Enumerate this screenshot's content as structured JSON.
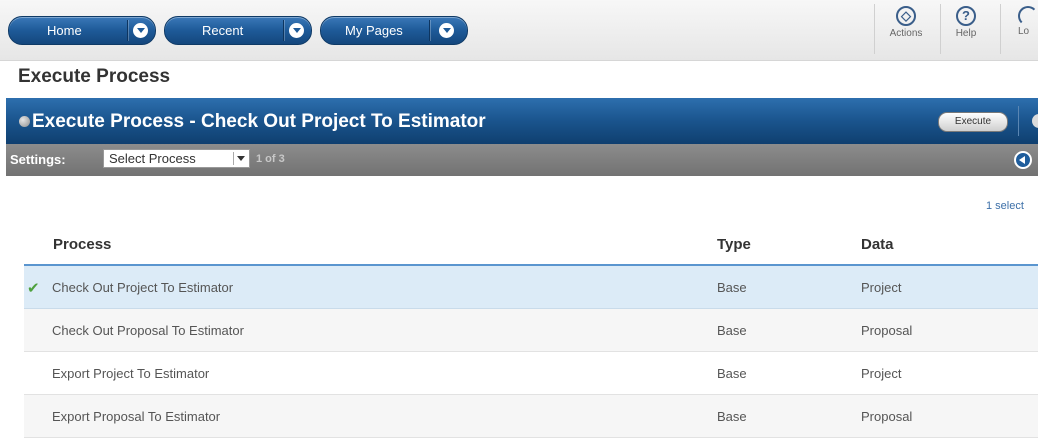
{
  "nav": {
    "home": "Home",
    "recent": "Recent",
    "my_pages": "My Pages"
  },
  "toolbar": {
    "actions": "Actions",
    "help": "Help",
    "logout": "Lo"
  },
  "page": {
    "title": "Execute Process"
  },
  "header": {
    "title": "Execute Process - Check Out Project To Estimator",
    "execute": "Execute"
  },
  "settings": {
    "label": "Settings:",
    "select_value": "Select Process",
    "pager": "1 of 3"
  },
  "selection": {
    "count_text": "1 select"
  },
  "table": {
    "headers": [
      "Process",
      "Type",
      "Data"
    ],
    "rows": [
      {
        "process": "Check Out Project To Estimator",
        "type": "Base",
        "data": "Project",
        "selected": true
      },
      {
        "process": "Check Out Proposal To Estimator",
        "type": "Base",
        "data": "Proposal",
        "selected": false
      },
      {
        "process": "Export Project To Estimator",
        "type": "Base",
        "data": "Project",
        "selected": false
      },
      {
        "process": "Export Proposal To Estimator",
        "type": "Base",
        "data": "Proposal",
        "selected": false
      }
    ]
  },
  "colors": {
    "accent": "#1e5a98",
    "selected_row": "#dcebf7",
    "check": "#4ea13e"
  }
}
